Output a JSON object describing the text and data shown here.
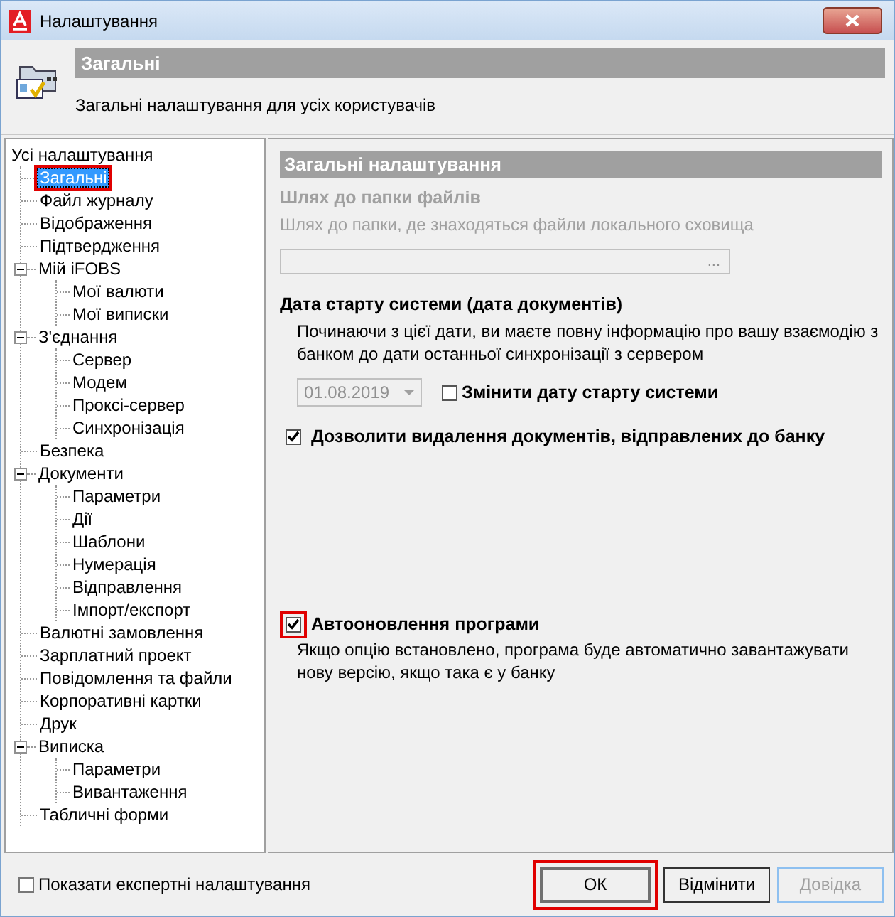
{
  "window": {
    "title": "Налаштування"
  },
  "header": {
    "title": "Загальні",
    "description": "Загальні налаштування для усіх користувачів"
  },
  "tree": {
    "items": [
      {
        "label": "Усі налаштування",
        "selected": false,
        "highlighted": false,
        "children": [
          {
            "label": "Загальні",
            "selected": true,
            "highlighted": true
          },
          {
            "label": "Файл журналу",
            "selected": false,
            "highlighted": false
          },
          {
            "label": "Відображення",
            "selected": false,
            "highlighted": false
          },
          {
            "label": "Підтвердження",
            "selected": false,
            "highlighted": false
          },
          {
            "label": "Мій iFOBS",
            "selected": false,
            "highlighted": false,
            "expanded": true,
            "children": [
              {
                "label": "Мої валюти",
                "selected": false,
                "highlighted": false
              },
              {
                "label": "Мої виписки",
                "selected": false,
                "highlighted": false
              }
            ]
          },
          {
            "label": "З'єднання",
            "selected": false,
            "highlighted": false,
            "expanded": true,
            "children": [
              {
                "label": "Сервер",
                "selected": false,
                "highlighted": false
              },
              {
                "label": "Модем",
                "selected": false,
                "highlighted": false
              },
              {
                "label": "Проксі-сервер",
                "selected": false,
                "highlighted": false
              },
              {
                "label": "Синхронізація",
                "selected": false,
                "highlighted": false
              }
            ]
          },
          {
            "label": "Безпека",
            "selected": false,
            "highlighted": false
          },
          {
            "label": "Документи",
            "selected": false,
            "highlighted": false,
            "expanded": true,
            "children": [
              {
                "label": "Параметри",
                "selected": false,
                "highlighted": false
              },
              {
                "label": "Дії",
                "selected": false,
                "highlighted": false
              },
              {
                "label": "Шаблони",
                "selected": false,
                "highlighted": false
              },
              {
                "label": "Нумерація",
                "selected": false,
                "highlighted": false
              },
              {
                "label": "Відправлення",
                "selected": false,
                "highlighted": false
              },
              {
                "label": "Імпорт/експорт",
                "selected": false,
                "highlighted": false
              }
            ]
          },
          {
            "label": "Валютні замовлення",
            "selected": false,
            "highlighted": false
          },
          {
            "label": "Зарплатний проект",
            "selected": false,
            "highlighted": false
          },
          {
            "label": "Повідомлення та файли",
            "selected": false,
            "highlighted": false
          },
          {
            "label": "Корпоративні картки",
            "selected": false,
            "highlighted": false
          },
          {
            "label": "Друк",
            "selected": false,
            "highlighted": false
          },
          {
            "label": "Виписка",
            "selected": false,
            "highlighted": false,
            "expanded": true,
            "children": [
              {
                "label": "Параметри",
                "selected": false,
                "highlighted": false
              },
              {
                "label": "Вивантаження",
                "selected": false,
                "highlighted": false
              }
            ]
          },
          {
            "label": "Табличні форми",
            "selected": false,
            "highlighted": false
          }
        ]
      }
    ]
  },
  "settings": {
    "section_title": "Загальні налаштування",
    "path": {
      "label": "Шлях до папки файлів",
      "hint": "Шлях до папки, де знаходяться файли локального сховища",
      "button": "...",
      "disabled": true
    },
    "start_date": {
      "label": "Дата старту системи (дата документів)",
      "description": "Починаючи з цієї дати, ви маєте повну інформацію про вашу взаємодію з банком до дати останньої синхронізації з сервером",
      "date": "01.08.2019",
      "date_disabled": true,
      "change": {
        "label": "Змінити дату старту системи",
        "checked": false
      }
    },
    "options": [
      {
        "label": "Дозволити видалення документів, відправлених до банку",
        "checked": true,
        "highlighted": false
      },
      {
        "label": "Автооновлення програми",
        "checked": true,
        "highlighted": true,
        "description": "Якщо опцію встановлено, програма буде автоматично завантажувати нову версію, якщо така є у банку"
      }
    ]
  },
  "footer": {
    "expert": {
      "label": "Показати експертні налаштування",
      "checked": false
    },
    "buttons": [
      {
        "label": "ОК",
        "default": true,
        "disabled": false,
        "highlighted": true
      },
      {
        "label": "Відмінити",
        "default": false,
        "disabled": false,
        "highlighted": false
      },
      {
        "label": "Довідка",
        "default": false,
        "disabled": true,
        "highlighted": false
      }
    ]
  }
}
